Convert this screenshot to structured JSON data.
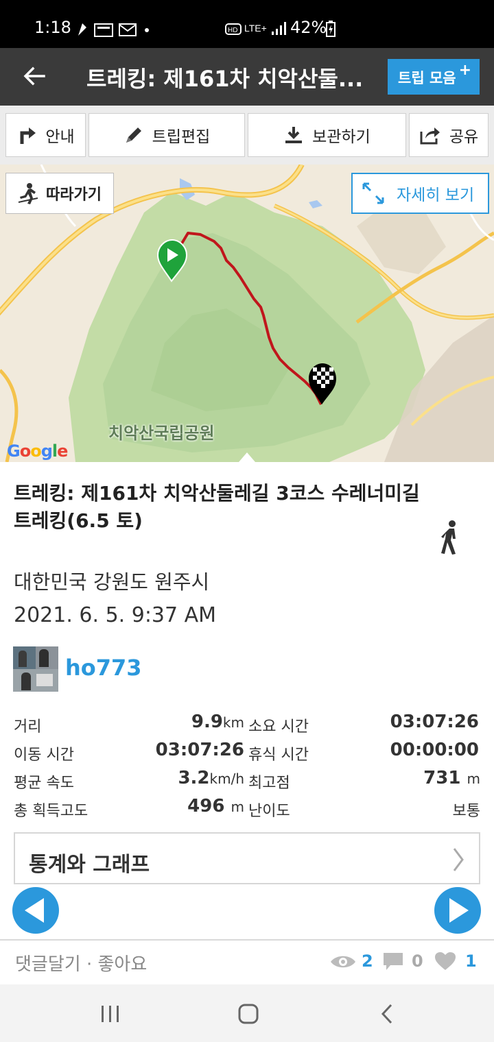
{
  "status_bar": {
    "time": "1:18",
    "network": "LTE+",
    "battery": "42%"
  },
  "header": {
    "back_label": "←",
    "title": "트레킹: 제161차 치악산둘...",
    "trip_button": "트립 모음",
    "trip_button_plus": "+"
  },
  "toolbar": {
    "guide": "안내",
    "edit": "트립편집",
    "save": "보관하기",
    "share": "공유"
  },
  "map": {
    "follow_label": "따라가기",
    "detail_label": "자세히 보기",
    "park_name": "치악산국립공원",
    "google_label": "Google"
  },
  "trip": {
    "title": "트레킹: 제161차 치악산둘레길 3코스 수레너미길 트레킹(6.5  토)",
    "location": "대한민국 강원도 원주시",
    "datetime": "2021. 6. 5. 9:37 AM",
    "username": "ho773",
    "activity_icon": "walking-icon"
  },
  "stats": {
    "distance_label": "거리",
    "distance_value": "9.9",
    "distance_unit": "km",
    "duration_label": "소요 시간",
    "duration_value": "03:07:26",
    "moving_label": "이동 시간",
    "moving_value": "03:07:26",
    "rest_label": "휴식 시간",
    "rest_value": "00:00:00",
    "speed_label": "평균 속도",
    "speed_value": "3.2",
    "speed_unit": "km/h",
    "highest_label": "최고점",
    "highest_value": "731",
    "highest_unit": "m",
    "gain_label": "총 획득고도",
    "gain_value": "496",
    "gain_unit": "m",
    "difficulty_label": "난이도",
    "difficulty_value": "보통"
  },
  "graph_button": "통계와 그래프",
  "footer": {
    "comment_label": "댓글달기 · 좋아요",
    "views": "2",
    "comments": "0",
    "likes": "1"
  },
  "colors": {
    "accent": "#2b98dc",
    "header_bg": "#3a3a3a",
    "route": "#c0161c"
  }
}
